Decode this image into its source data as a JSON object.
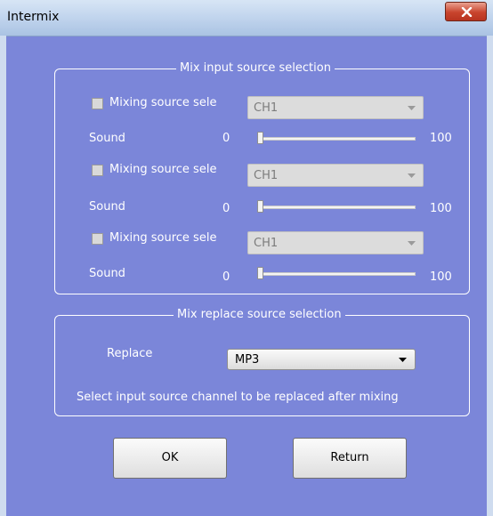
{
  "window": {
    "title": "Intermix"
  },
  "mix_input": {
    "title": "Mix input source selection",
    "rows": [
      {
        "checkbox_label": "Mixing source sele",
        "checked": false,
        "channel": "CH1",
        "sound_label": "Sound",
        "min": "0",
        "max": "100",
        "level_fraction": 0
      },
      {
        "checkbox_label": "Mixing source sele",
        "checked": false,
        "channel": "CH1",
        "sound_label": "Sound",
        "min": "0",
        "max": "100",
        "level_fraction": 0
      },
      {
        "checkbox_label": "Mixing source sele",
        "checked": false,
        "channel": "CH1",
        "sound_label": "Sound",
        "min": "0",
        "max": "100",
        "level_fraction": 0
      }
    ]
  },
  "mix_replace": {
    "title": "Mix replace source selection",
    "replace_label": "Replace",
    "replace_value": "MP3",
    "hint": "Select input source channel to be replaced after mixing"
  },
  "buttons": {
    "ok": "OK",
    "return": "Return"
  },
  "colors": {
    "background": "#7b86d9",
    "close_button": "#c8442d"
  }
}
